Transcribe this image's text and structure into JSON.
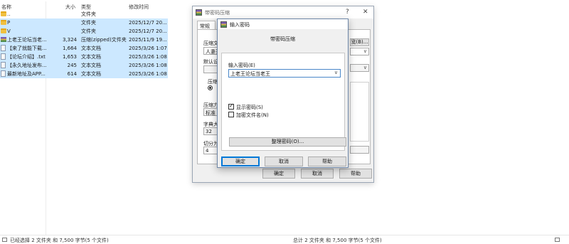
{
  "file_list": {
    "headers": {
      "name": "名称",
      "size": "大小",
      "type": "类型",
      "date": "修改时间"
    },
    "rows": [
      {
        "name": "..",
        "size": "",
        "type": "文件夹",
        "date": "",
        "icon": "folder-icon",
        "selected": false
      },
      {
        "name": "P",
        "size": "",
        "type": "文件夹",
        "date": "2025/12/7 20...",
        "icon": "folder-icon",
        "selected": true
      },
      {
        "name": "V",
        "size": "",
        "type": "文件夹",
        "date": "2025/12/7 20...",
        "icon": "folder-icon",
        "selected": true
      },
      {
        "name": "上老王论坛当老...",
        "size": "3,324",
        "type": "压缩(zipped)文件夹",
        "date": "2025/11/9 19...",
        "icon": "zip-archive-icon",
        "selected": true
      },
      {
        "name": "【来了就能下载...",
        "size": "1,664",
        "type": "文本文档",
        "date": "2025/3/26 1:07",
        "icon": "text-file-icon",
        "selected": true
      },
      {
        "name": "【论坛介绍】.txt",
        "size": "1,653",
        "type": "文本文档",
        "date": "2025/3/26 1:08",
        "icon": "text-file-icon",
        "selected": true
      },
      {
        "name": "【永久地址发布...",
        "size": "245",
        "type": "文本文档",
        "date": "2025/3/26 1:08",
        "icon": "text-file-icon",
        "selected": true
      },
      {
        "name": "最新地址及APP...",
        "size": "614",
        "type": "文本文档",
        "date": "2025/3/26 1:08",
        "icon": "text-file-icon",
        "selected": true
      }
    ]
  },
  "status_bar": {
    "left": "已经选择 2 文件夹 和 7,500 字节(5 个文件)",
    "right": "总计 2 文件夹 和 7,500 字节(5 个文件)"
  },
  "archive_dialog": {
    "title": "带密码压缩",
    "help_glyph": "?",
    "close_glyph": "✕",
    "tab": "常规",
    "labels": {
      "archive_name": "压缩文",
      "default": "默认设",
      "format": "压缩方",
      "method_value": "标准",
      "dict": "字典大",
      "dict_value": "32",
      "split": "切分为",
      "split_value": "4",
      "archive_label": "压缩",
      "archive_name_value": "人妻圣"
    },
    "browse_button": "览(B)...",
    "buttons": {
      "ok": "确定",
      "cancel": "取消",
      "help": "帮助"
    }
  },
  "password_dialog": {
    "title": "输入密码",
    "subtitle": "带密码压缩",
    "input_label": "输入密码(E)",
    "input_value": "上老王论坛当老王",
    "show_password": {
      "label": "显示密码(S)",
      "checked": true
    },
    "encrypt_names": {
      "label": "加密文件名(N)",
      "checked": false
    },
    "organize_button": "整理密码(O)...",
    "buttons": {
      "ok": "确定",
      "cancel": "取消",
      "help": "帮助"
    }
  }
}
